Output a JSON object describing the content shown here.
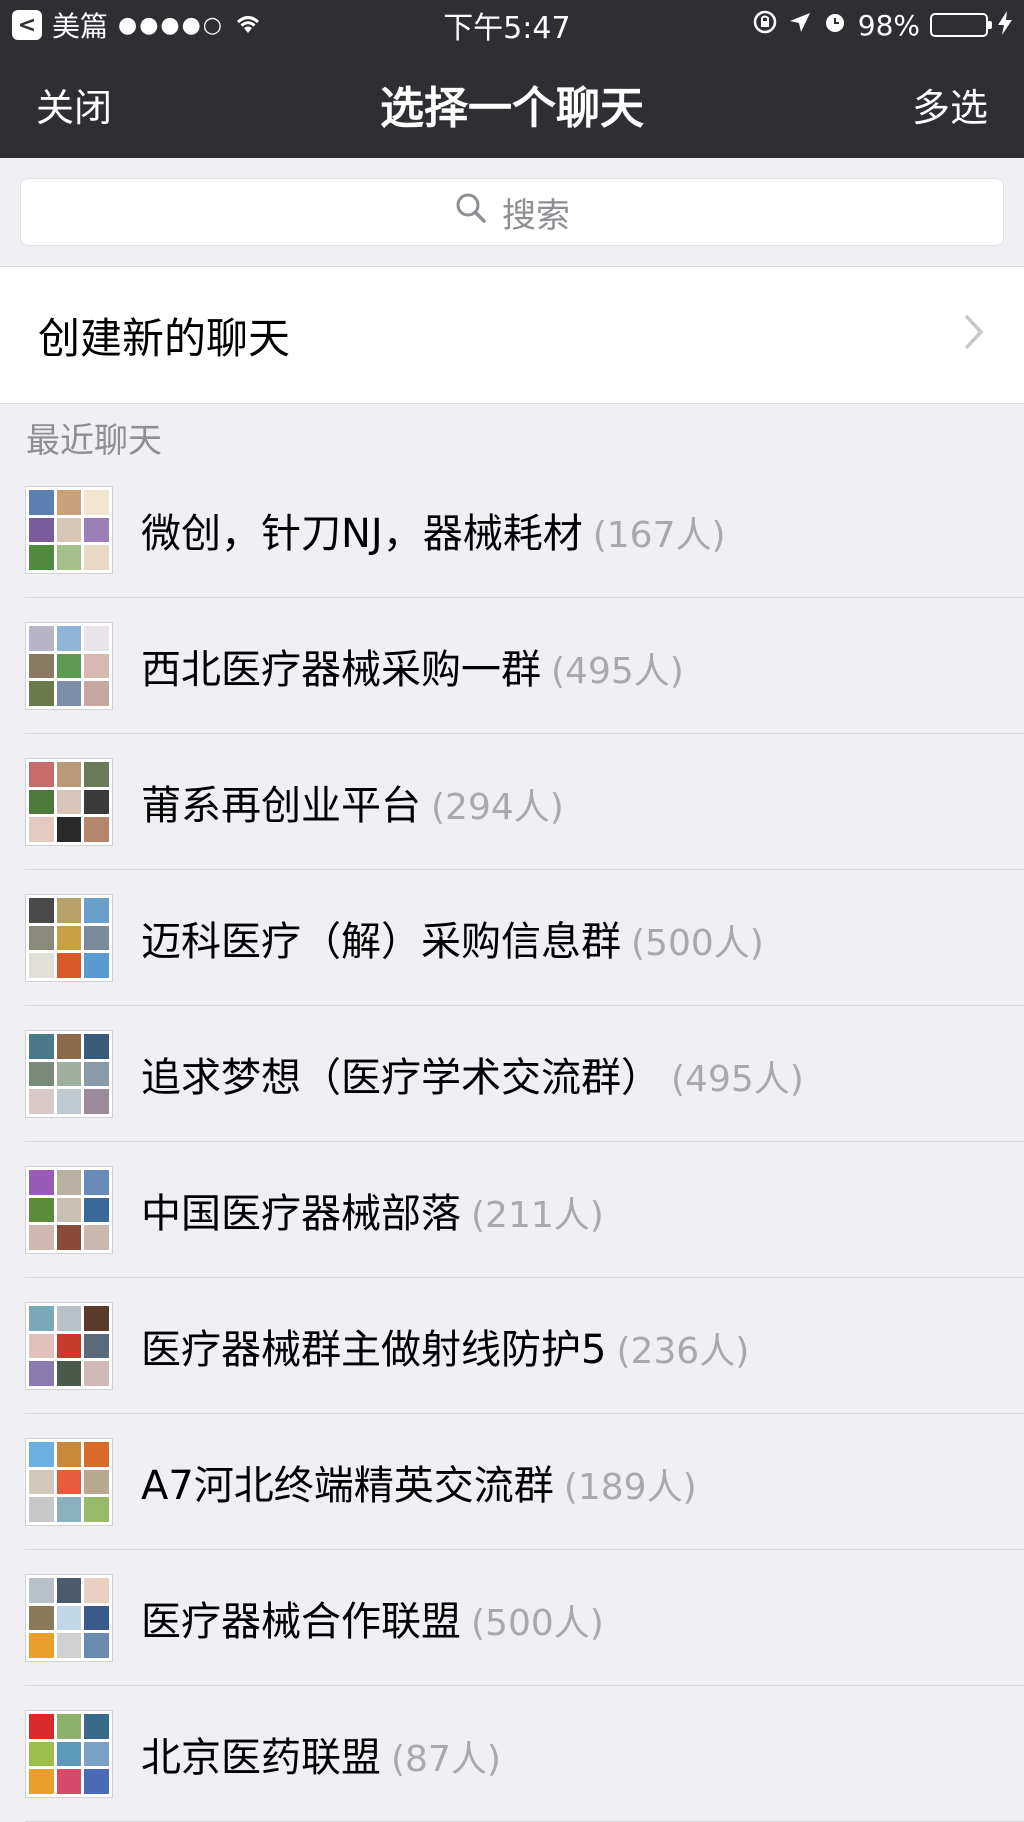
{
  "status_bar": {
    "back_app": "美篇",
    "signal": "●●●●○",
    "time": "下午5:47",
    "battery_percent": "98%",
    "battery_level": 0.98
  },
  "nav": {
    "left": "关闭",
    "title": "选择一个聊天",
    "right": "多选"
  },
  "search": {
    "placeholder": "搜索"
  },
  "new_chat": {
    "label": "创建新的聊天"
  },
  "section": {
    "recent": "最近聊天"
  },
  "chats": [
    {
      "name": "微创，针刀NJ，器械耗材",
      "count": "(167人)",
      "colors": [
        "#5a7fb0",
        "#c9a27a",
        "#f0e6d2",
        "#7a5c9e",
        "#d8c6b4",
        "#9a7fb8",
        "#4f8a3d",
        "#a4c08a",
        "#e8d8c8"
      ]
    },
    {
      "name": "西北医疗器械采购一群",
      "count": "(495人)",
      "colors": [
        "#b8b4c8",
        "#8fb4d8",
        "#e9e4ea",
        "#8a7a62",
        "#5e9a52",
        "#d7b8b0",
        "#6b7a4a",
        "#7d8ea8",
        "#c6a7a0"
      ]
    },
    {
      "name": "莆系再创业平台",
      "count": "(294人)",
      "colors": [
        "#c86b6b",
        "#b89a7a",
        "#6b7a5a",
        "#4d7a3a",
        "#d9c6b8",
        "#3a3a3a",
        "#e3c9c0",
        "#2a2a2a",
        "#b5866b"
      ]
    },
    {
      "name": "迈科医疗（解）采购信息群",
      "count": "(500人)",
      "colors": [
        "#4a4a4a",
        "#b8a06a",
        "#6aa0c8",
        "#8a8a7a",
        "#c8a040",
        "#7a8a9a",
        "#e0e0d8",
        "#d85a2a",
        "#5a9ad0"
      ]
    },
    {
      "name": "追求梦想（医疗学术交流群）",
      "count": "(495人)",
      "colors": [
        "#4a7a8a",
        "#8a6a4a",
        "#3a5a7a",
        "#7a8a7a",
        "#a0b0a0",
        "#8a9aaa",
        "#d8c8c8",
        "#c0c8d0",
        "#9a8a9a"
      ]
    },
    {
      "name": "中国医疗器械部落",
      "count": "(211人)",
      "colors": [
        "#9a5ab8",
        "#b8b0a0",
        "#6a8ab8",
        "#5a8a3a",
        "#c8c0b0",
        "#3a6a9a",
        "#d0b8b0",
        "#8a4a3a",
        "#c8b8b0"
      ]
    },
    {
      "name": "医疗器械群主做射线防护5",
      "count": "(236人)",
      "colors": [
        "#7aa8b8",
        "#b8c0c8",
        "#5a3a2a",
        "#e0c0b8",
        "#c83a2a",
        "#5a6a7a",
        "#8a7ab0",
        "#4a5a4a",
        "#d0b8b8"
      ]
    },
    {
      "name": "A7河北终端精英交流群",
      "count": "(189人)",
      "colors": [
        "#6ab0e0",
        "#c88a3a",
        "#d86a2a",
        "#d0c8b8",
        "#e85a3a",
        "#b8a890",
        "#c8c8c8",
        "#8ab0c0",
        "#9ab86a"
      ]
    },
    {
      "name": "医疗器械合作联盟",
      "count": "(500人)",
      "colors": [
        "#b8c0c8",
        "#4a5a6a",
        "#e8d0c0",
        "#8a7a5a",
        "#c0d8e8",
        "#3a5a8a",
        "#e8a02a",
        "#d0d0d0",
        "#6a8ab0"
      ]
    },
    {
      "name": "北京医药联盟",
      "count": "(87人)",
      "colors": [
        "#d82a2a",
        "#8ab06a",
        "#3a6a8a",
        "#9ac04a",
        "#5a9ab8",
        "#7aa0c8",
        "#e8a02a",
        "#d84a6a",
        "#4a6ab8"
      ]
    }
  ]
}
